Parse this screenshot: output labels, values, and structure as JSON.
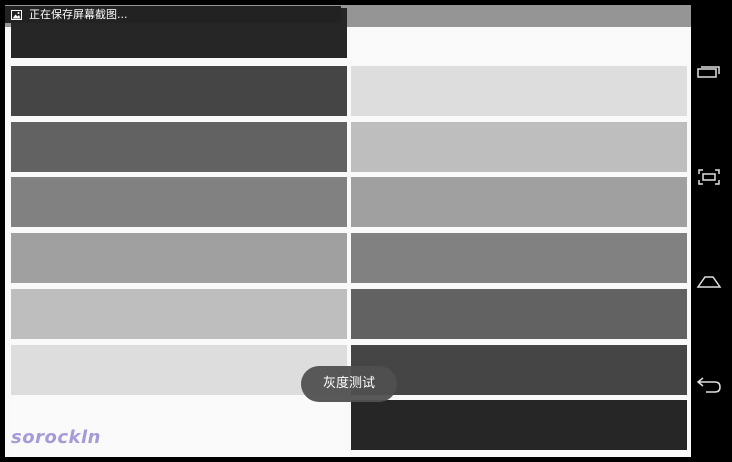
{
  "status_bar": {
    "notification_text": "正在保存屏幕截图...",
    "notification_icon": "image-icon"
  },
  "gray_test": {
    "left_swatches": [
      "#262626",
      "#454545",
      "#626262",
      "#818181",
      "#a0a0a0",
      "#bebebe",
      "#dddddd",
      "#fafafa"
    ],
    "right_swatches": [
      "#fafafa",
      "#dddddd",
      "#bebebe",
      "#a0a0a0",
      "#818181",
      "#626262",
      "#454545",
      "#262626"
    ]
  },
  "toast": {
    "text": "灰度测试"
  },
  "watermark": {
    "text": "sorockln",
    "color": "#a79ad8"
  },
  "nav_bar": {
    "buttons": [
      {
        "name": "recent-apps",
        "icon": "recent-apps-icon"
      },
      {
        "name": "screenshot",
        "icon": "screenshot-icon"
      },
      {
        "name": "home",
        "icon": "home-icon"
      },
      {
        "name": "back",
        "icon": "back-icon"
      }
    ]
  }
}
